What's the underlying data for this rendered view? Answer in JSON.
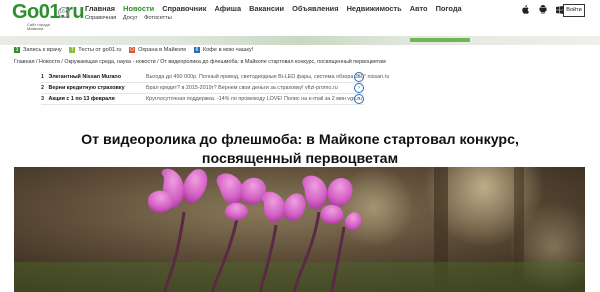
{
  "header": {
    "logo_text": "Go01.ru",
    "logo_tagline": "Сайт города Майкопа",
    "logo_badge": "16+",
    "nav": [
      {
        "label": "Главная",
        "active": false
      },
      {
        "label": "Новости",
        "active": true
      },
      {
        "label": "Справочник",
        "active": false
      },
      {
        "label": "Афиша",
        "active": false
      },
      {
        "label": "Вакансии",
        "active": false
      },
      {
        "label": "Объявления",
        "active": false
      },
      {
        "label": "Недвижимость",
        "active": false
      },
      {
        "label": "Авто",
        "active": false
      },
      {
        "label": "Погода",
        "active": false
      }
    ],
    "subnav": [
      "Справочная",
      "Досуг",
      "Фотосетты"
    ],
    "os_icons": [
      "apple-icon",
      "android-icon",
      "windows-icon"
    ],
    "login_label": "Войти",
    "brand_color": "#2f8f2f"
  },
  "pills": [
    {
      "label": "Запись к врачу",
      "color": "#2f8f2f",
      "icon": "3"
    },
    {
      "label": "Тесты от go01.ru",
      "color": "#8bbf3a",
      "icon": "T"
    },
    {
      "label": "Охрана в Майкопе",
      "color": "#e0533b",
      "icon": "О"
    },
    {
      "label": "Кофе в мою чашку!",
      "color": "#2a6db5",
      "icon": "К"
    }
  ],
  "breadcrumb": [
    "Главная",
    "Новости",
    "Окружающая среда, наука - новости",
    "От видеоролика до флешмоба: в Майкопе стартовал конкурс, посвященный первоцветам"
  ],
  "ads": [
    {
      "n": "1",
      "title": "Элегантный Nissan Murano",
      "desc": "Выгода до 450 000р. Полный привод, светодиодные Bi-LED фары, система обзора 360° nissan.ru"
    },
    {
      "n": "2",
      "title": "Верни кредитную страховку",
      "desc": "Брал кредит? в 2015-2019г? Вернем свои деньги за страховку! vfizi-promo.ru"
    },
    {
      "n": "3",
      "title": "Акция с 1 по 13 февраля",
      "desc": "Круглосуточная поддержка. -14% по промокоду LOVE! Полис на e-mail за 2 мин vgs.ru"
    }
  ],
  "article": {
    "title": "От видеоролика до флешмоба: в Майкопе стартовал конкурс, посвященный первоцветам",
    "photo_subject": "pink cyclamen flowers"
  }
}
